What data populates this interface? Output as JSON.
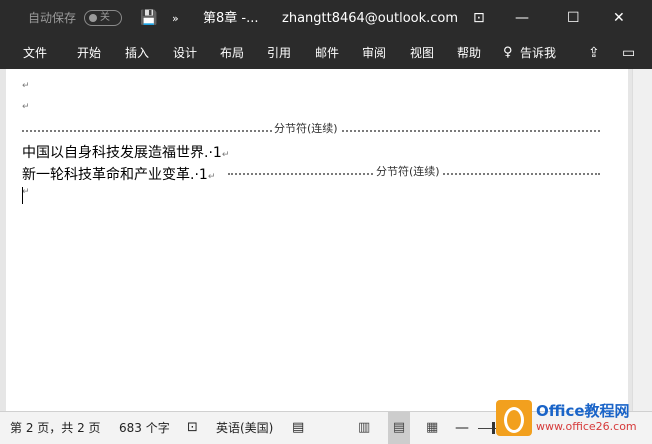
{
  "titlebar": {
    "autosave_label": "自动保存",
    "autosave_state": "关",
    "save_icon": "💾",
    "qa_more": "»",
    "doc_title": "第8章 -...",
    "account": "zhangtt8464@outlook.com",
    "ribbon_icon": "⊡",
    "minimize": "—",
    "maximize": "☐",
    "close": "✕"
  },
  "menu": {
    "tabs": [
      "文件",
      "开始",
      "插入",
      "设计",
      "布局",
      "引用",
      "邮件",
      "审阅",
      "视图",
      "帮助"
    ],
    "tellme_icon": "♀",
    "tellme": "告诉我",
    "share_icon": "⇪",
    "comment_icon": "▭"
  },
  "document": {
    "para_mark": "↵",
    "section_break": "分节符(连续)",
    "line1": "中国以自身科技发展造福世界.·1",
    "line2": "新一轮科技革命和产业变革.·1"
  },
  "status": {
    "page": "第 2 页，共 2 页",
    "words": "683 个字",
    "proof_icon": "⊡",
    "language": "英语(美国)",
    "macro_icon": "▤",
    "view_read_icon": "▥",
    "view_print_icon": "▤",
    "view_web_icon": "▦",
    "zoom_minus": "—"
  },
  "watermark": {
    "line1": "Office教程网",
    "line2": "www.office26.com"
  }
}
